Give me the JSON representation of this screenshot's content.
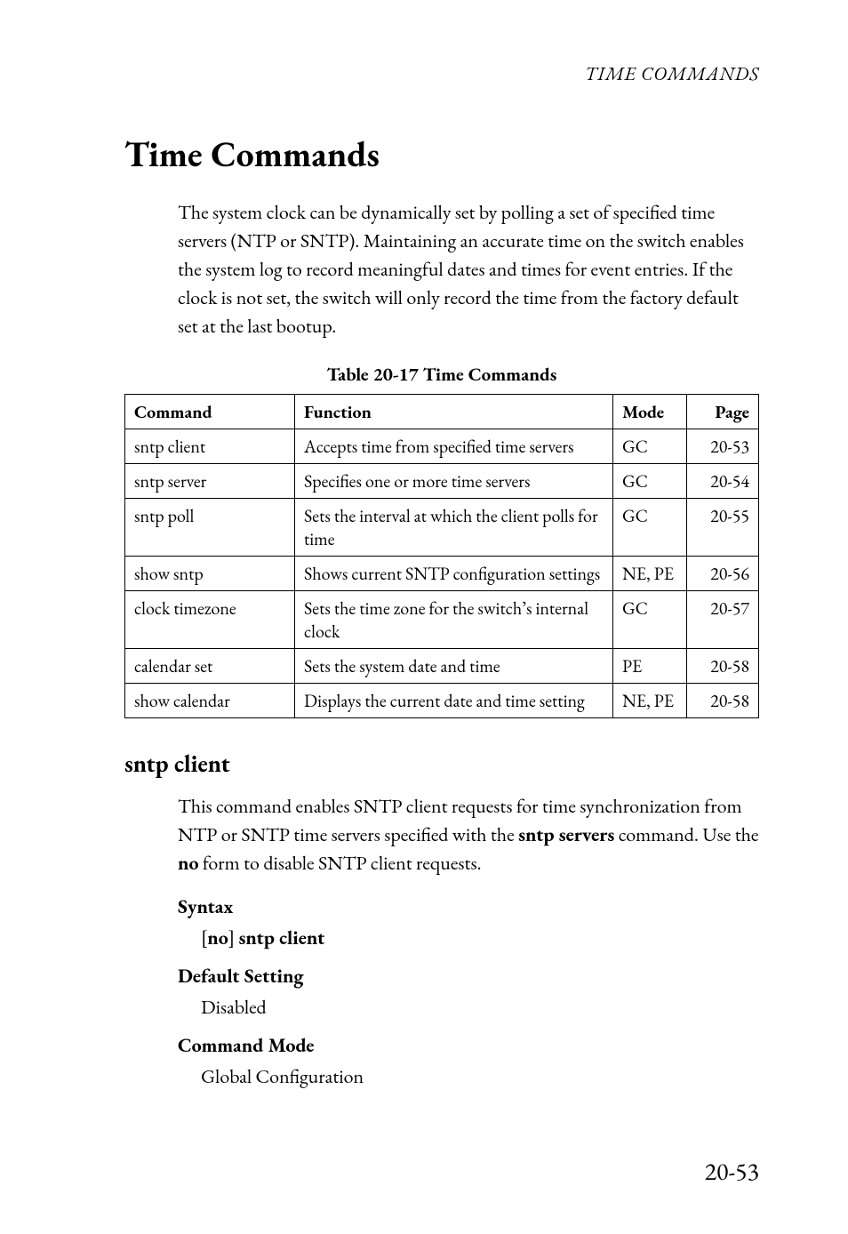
{
  "running_head": "TIME COMMANDS",
  "section_title": "Time Commands",
  "intro_paragraph": "The system clock can be dynamically set by polling a set of specified time servers (NTP or SNTP). Maintaining an accurate time on the switch enables the system log to record meaningful dates and times for event entries. If the clock is not set, the switch will only record the time from the factory default set at the last bootup.",
  "table": {
    "caption": "Table 20-17  Time Commands",
    "headers": {
      "command": "Command",
      "function": "Function",
      "mode": "Mode",
      "page": "Page"
    },
    "rows": [
      {
        "command": "sntp client",
        "function": "Accepts time from specified time servers",
        "mode": "GC",
        "page": "20-53"
      },
      {
        "command": "sntp server",
        "function": "Specifies one or more time servers",
        "mode": "GC",
        "page": "20-54"
      },
      {
        "command": "sntp poll",
        "function": "Sets the interval at which the client polls for time",
        "mode": "GC",
        "page": "20-55"
      },
      {
        "command": "show sntp",
        "function": "Shows current SNTP configuration settings",
        "mode": "NE, PE",
        "page": "20-56"
      },
      {
        "command": "clock timezone",
        "function": "Sets the time zone for the switch’s internal clock",
        "mode": "GC",
        "page": "20-57"
      },
      {
        "command": "calendar set",
        "function": "Sets the system date and time",
        "mode": "PE",
        "page": "20-58"
      },
      {
        "command": "show calendar",
        "function": "Displays the current date and time setting",
        "mode": "NE, PE",
        "page": "20-58"
      }
    ]
  },
  "subsection": {
    "title": "sntp client",
    "intro_prefix": "This command enables SNTP client requests for time synchronization from NTP or SNTP time servers specified with the ",
    "intro_bold1": "sntp servers",
    "intro_mid": " command. Use the ",
    "intro_bold2": "no",
    "intro_suffix": " form to disable SNTP client requests.",
    "syntax": {
      "label": "Syntax",
      "bracket_open": "[",
      "no": "no",
      "bracket_close": "] ",
      "cmd": "sntp client"
    },
    "default_setting": {
      "label": "Default Setting",
      "value": "Disabled"
    },
    "command_mode": {
      "label": "Command Mode",
      "value": "Global Configuration"
    }
  },
  "page_number": "20-53"
}
